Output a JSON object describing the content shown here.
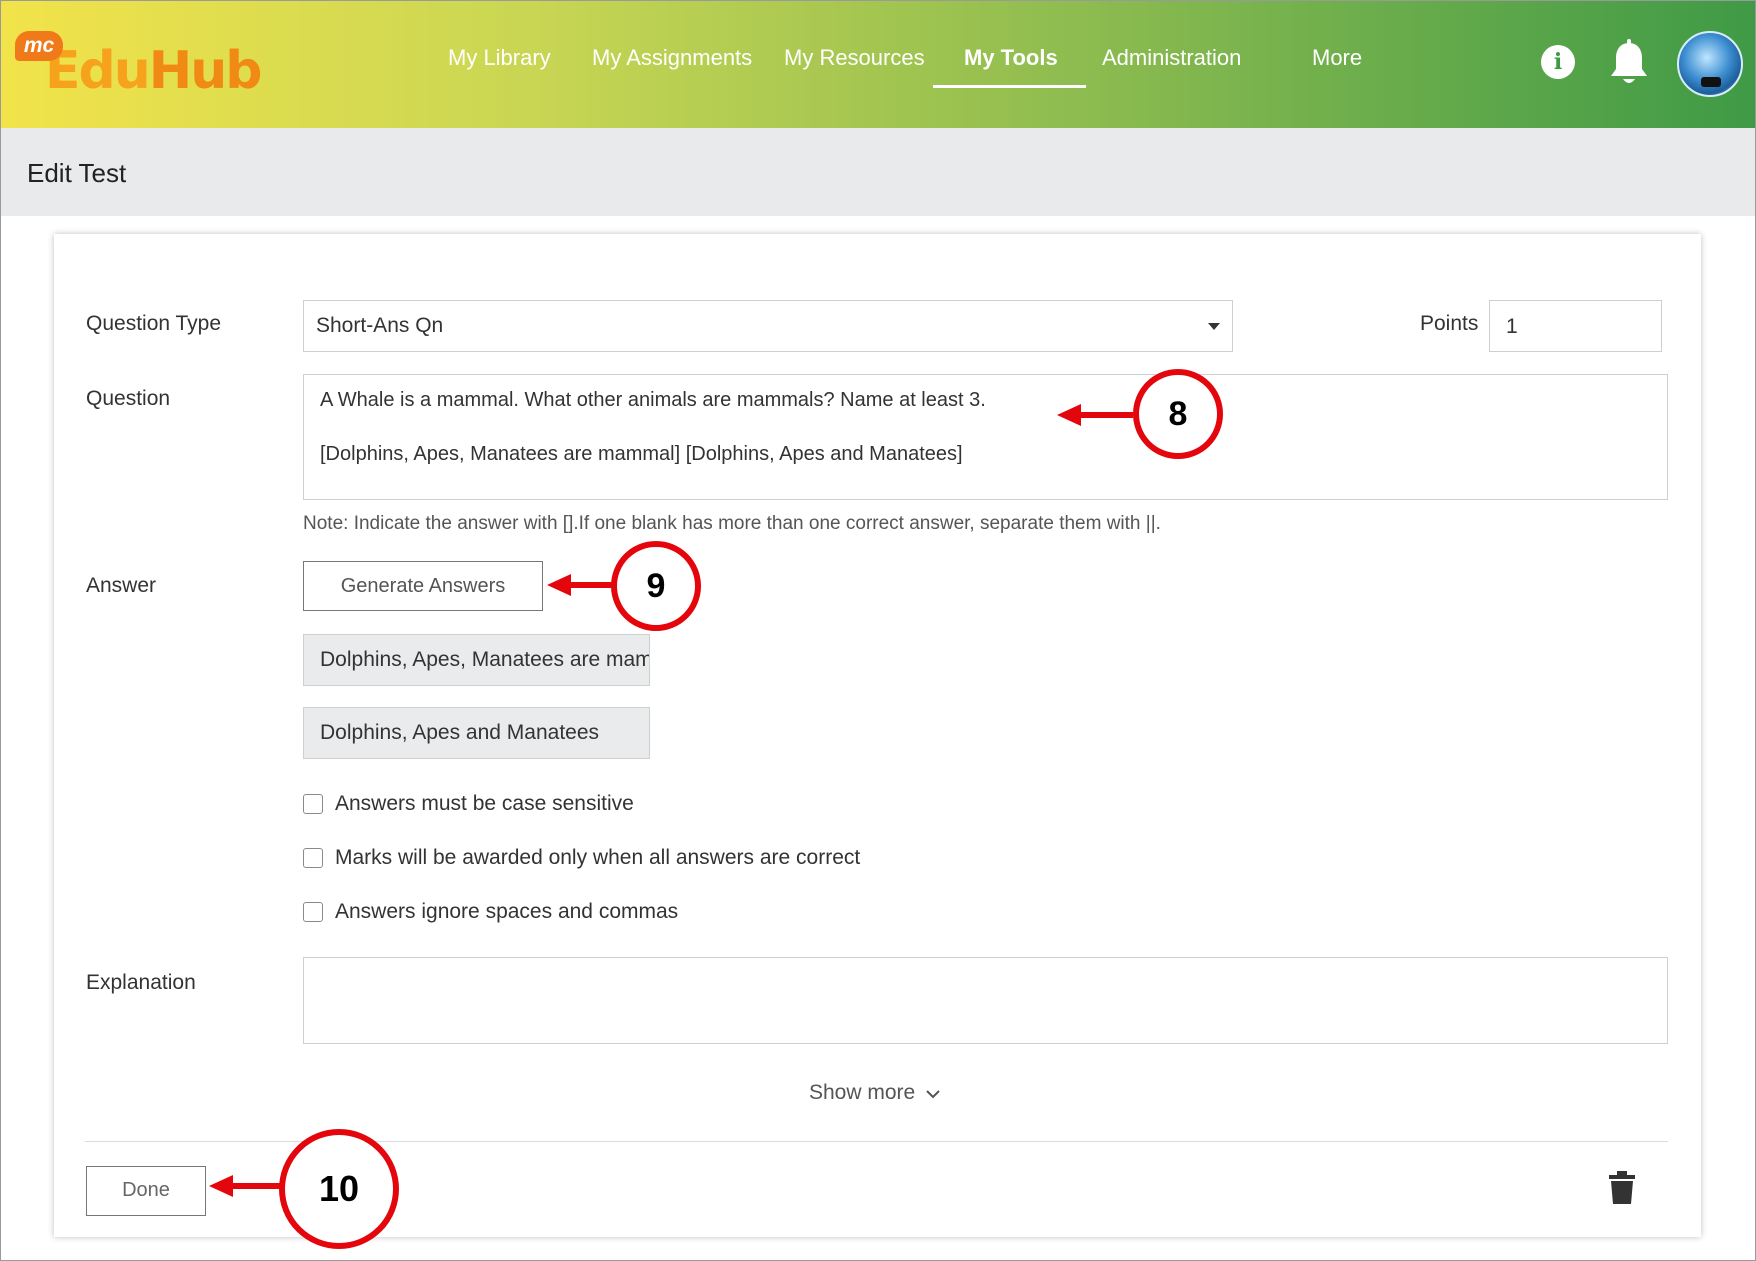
{
  "app": {
    "logo_badge": "mc",
    "logo_name_1": "Edu",
    "logo_name_2": "Hub"
  },
  "nav": {
    "items": [
      {
        "label": "My Library",
        "active": false
      },
      {
        "label": "My Assignments",
        "active": false
      },
      {
        "label": "My Resources",
        "active": false
      },
      {
        "label": "My Tools",
        "active": true
      },
      {
        "label": "Administration",
        "active": false
      },
      {
        "label": "More",
        "active": false
      }
    ],
    "info_glyph": "i"
  },
  "page": {
    "title": "Edit Test"
  },
  "form": {
    "question_type_label": "Question Type",
    "question_type_value": "Short-Ans Qn",
    "points_label": "Points",
    "points_value": "1",
    "question_label": "Question",
    "question_line_1": "A Whale is a mammal. What other animals are mammals? Name at least 3.",
    "question_line_2": "[Dolphins, Apes, Manatees are mammal] [Dolphins, Apes and Manatees]",
    "note": "Note: Indicate the answer with [].If one blank has more than one correct answer, separate them with ||.",
    "answer_label": "Answer",
    "generate_button": "Generate Answers",
    "answers": [
      "Dolphins, Apes, Manatees are mammal",
      "Dolphins, Apes and Manatees"
    ],
    "options": [
      {
        "label": "Answers must be case sensitive",
        "checked": false
      },
      {
        "label": "Marks will be awarded only when all answers are correct",
        "checked": false
      },
      {
        "label": "Answers ignore spaces and commas",
        "checked": false
      }
    ],
    "explanation_label": "Explanation",
    "explanation_value": "",
    "show_more": "Show more",
    "done_button": "Done"
  },
  "annotations": {
    "callout_8": "8",
    "callout_9": "9",
    "callout_10": "10",
    "color": "#e3060d"
  },
  "colors": {
    "header_start": "#f2e34a",
    "header_end": "#3f9a46",
    "subheader_bg": "#e8eaec"
  }
}
